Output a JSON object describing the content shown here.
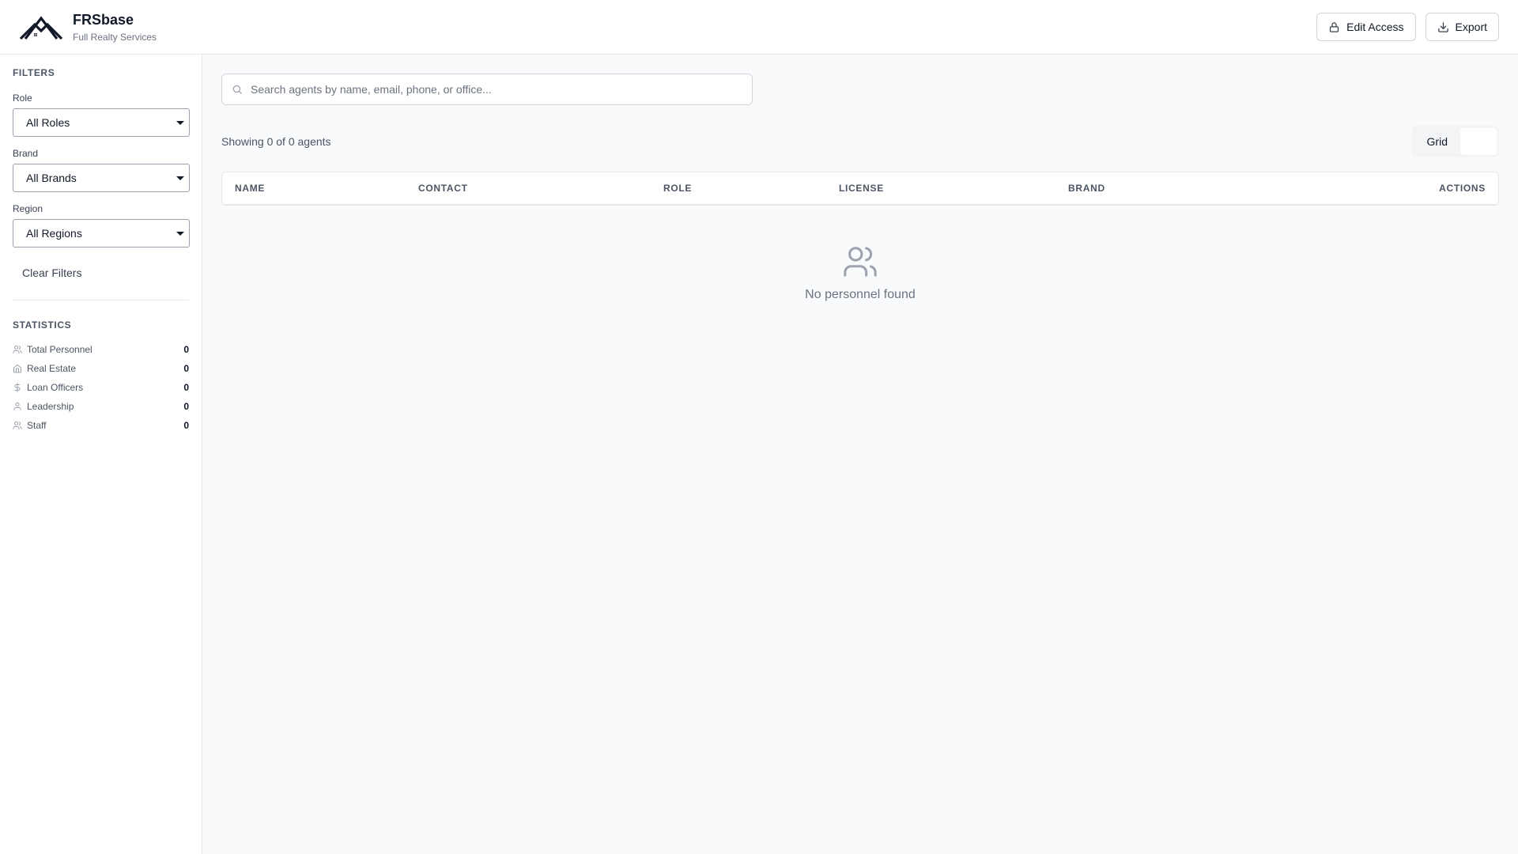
{
  "header": {
    "title": "FRSbase",
    "subtitle": "Full Realty Services",
    "edit_access_label": "Edit Access",
    "export_label": "Export"
  },
  "sidebar": {
    "filters_title": "FILTERS",
    "role": {
      "label": "Role",
      "selected": "All Roles"
    },
    "brand": {
      "label": "Brand",
      "selected": "All Brands"
    },
    "region": {
      "label": "Region",
      "selected": "All Regions"
    },
    "clear_label": "Clear Filters",
    "stats_title": "STATISTICS",
    "stats": [
      {
        "label": "Total Personnel",
        "value": "0",
        "icon": "users-icon"
      },
      {
        "label": "Real Estate",
        "value": "0",
        "icon": "home-icon"
      },
      {
        "label": "Loan Officers",
        "value": "0",
        "icon": "dollar-icon"
      },
      {
        "label": "Leadership",
        "value": "0",
        "icon": "user-icon"
      },
      {
        "label": "Staff",
        "value": "0",
        "icon": "users-icon"
      }
    ]
  },
  "main": {
    "search_placeholder": "Search agents by name, email, phone, or office...",
    "showing_text": "Showing 0 of 0 agents",
    "view_toggle": {
      "grid_label": "Grid",
      "list_label": ""
    },
    "table": {
      "columns": [
        "NAME",
        "CONTACT",
        "ROLE",
        "LICENSE",
        "BRAND",
        "ACTIONS"
      ]
    },
    "empty_text": "No personnel found"
  },
  "colors": {
    "border": "#e5e7eb",
    "muted_text": "#6b7280",
    "main_bg": "#f9fafb",
    "empty_icon": "#9ca3af"
  }
}
